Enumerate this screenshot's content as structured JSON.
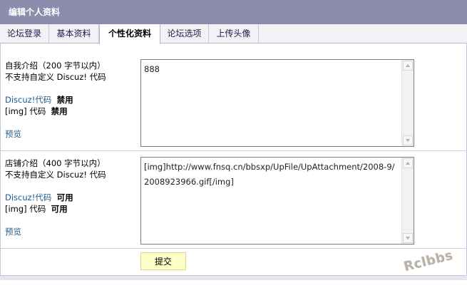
{
  "header": {
    "title": "编辑个人资料"
  },
  "tabs": [
    {
      "label": "论坛登录"
    },
    {
      "label": "基本资料"
    },
    {
      "label": "个性化资料"
    },
    {
      "label": "论坛选项"
    },
    {
      "label": "上传头像"
    }
  ],
  "active_tab": "个性化资料",
  "bio": {
    "title": "自我介绍（200 字节以内）",
    "note": "不支持自定义 Discuz! 代码",
    "discuz_code_label": "Discuz!代码",
    "discuz_code_status": "禁用",
    "img_code_label": "[img] 代码",
    "img_code_status": "禁用",
    "preview_link": "预览",
    "value": "888"
  },
  "shop": {
    "title": "店铺介绍（400 字节以内）",
    "note": "不支持自定义 Discuz! 代码",
    "discuz_code_label": "Discuz!代码",
    "discuz_code_status": "可用",
    "img_code_label": "[img] 代码",
    "img_code_status": "可用",
    "preview_link": "预览",
    "value": "[img]http://www.fnsq.cn/bbsxp/UpFile/UpAttachment/2008-9/2008923966.gif[/img]"
  },
  "submit": {
    "label": "提交"
  },
  "watermark": {
    "text": "Rclbbs"
  }
}
